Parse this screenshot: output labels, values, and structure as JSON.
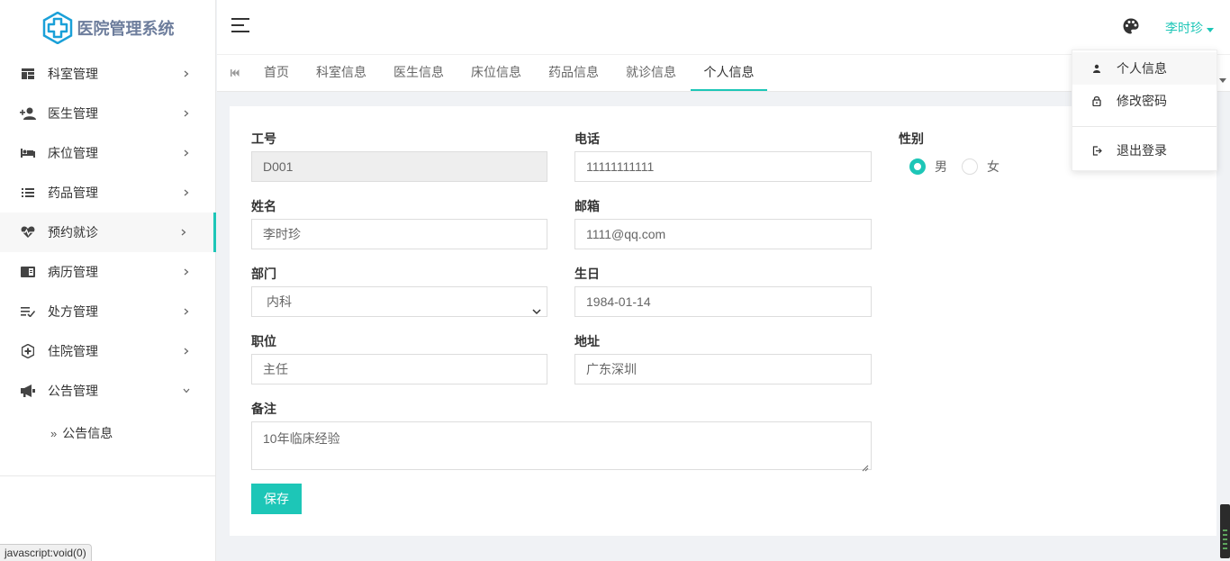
{
  "app": {
    "title": "医院管理系统"
  },
  "sidebar": {
    "items": [
      {
        "label": "科室管理",
        "icon": "dashboard-icon"
      },
      {
        "label": "医生管理",
        "icon": "user-add-icon"
      },
      {
        "label": "床位管理",
        "icon": "bed-icon"
      },
      {
        "label": "药品管理",
        "icon": "list-icon"
      },
      {
        "label": "预约就诊",
        "icon": "heartbeat-icon",
        "active": true
      },
      {
        "label": "病历管理",
        "icon": "book-icon"
      },
      {
        "label": "处方管理",
        "icon": "checklist-icon"
      },
      {
        "label": "住院管理",
        "icon": "shield-plus-icon"
      },
      {
        "label": "公告管理",
        "icon": "megaphone-icon",
        "expanded": true
      }
    ],
    "subitems": [
      {
        "label": "公告信息"
      }
    ]
  },
  "header": {
    "username": "李时珍"
  },
  "tabs": [
    {
      "label": "首页"
    },
    {
      "label": "科室信息"
    },
    {
      "label": "医生信息"
    },
    {
      "label": "床位信息"
    },
    {
      "label": "药品信息"
    },
    {
      "label": "就诊信息"
    },
    {
      "label": "个人信息",
      "active": true
    }
  ],
  "form": {
    "id_label": "工号",
    "id_value": "D001",
    "phone_label": "电话",
    "phone_value": "11111111111",
    "gender_label": "性别",
    "gender_male": "男",
    "gender_female": "女",
    "gender_selected": "男",
    "name_label": "姓名",
    "name_value": "李时珍",
    "email_label": "邮箱",
    "email_value": "1111@qq.com",
    "dept_label": "部门",
    "dept_value": "内科",
    "birthday_label": "生日",
    "birthday_value": "1984-01-14",
    "position_label": "职位",
    "position_value": "主任",
    "address_label": "地址",
    "address_value": "广东深圳",
    "remark_label": "备注",
    "remark_value": "10年临床经验",
    "save_label": "保存"
  },
  "dropdown": {
    "items": [
      {
        "label": "个人信息",
        "icon": "person-icon"
      },
      {
        "label": "修改密码",
        "icon": "lock-icon"
      },
      {
        "label": "退出登录",
        "icon": "logout-icon"
      }
    ]
  },
  "status": {
    "text": "javascript:void(0)"
  },
  "colors": {
    "accent": "#1dc6b7",
    "logo": "#1aa0d8"
  }
}
